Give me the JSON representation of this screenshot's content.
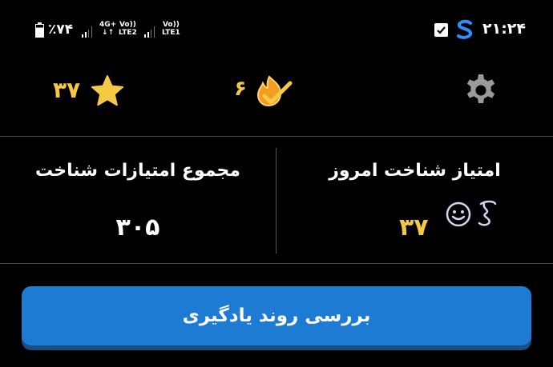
{
  "status_bar": {
    "battery_percent": "٪۷۴",
    "net1_top": "4G+",
    "net1_bottom": "↓↑",
    "vo1_top": "Vo))",
    "vo1_bottom": "LTE2",
    "vo2_top": "Vo))",
    "vo2_bottom": "LTE1",
    "time": "۲۱:۲۴",
    "icons": [
      "battery-icon",
      "signal-icon",
      "checkbox-notification-icon",
      "app-s-icon"
    ]
  },
  "stats": {
    "stars_value": "۳۷",
    "streak_value": "۶",
    "icons": [
      "star-icon",
      "streak-icon",
      "gear-icon"
    ]
  },
  "scores": {
    "total_title": "مجموع امتیازات شناخت",
    "total_value": "۳۰۵",
    "today_title": "امتیاز شناخت امروز",
    "today_value": "۳۷",
    "icons": [
      "smiley-icon",
      "script-icon"
    ]
  },
  "actions": {
    "review_label": "بررسی روند یادگیری"
  },
  "colors": {
    "background": "#000000",
    "accent_yellow": "#f6c944",
    "button_blue": "#1e7bd3",
    "button_shadow": "#1b4f84",
    "divider": "#4a4a4a"
  }
}
